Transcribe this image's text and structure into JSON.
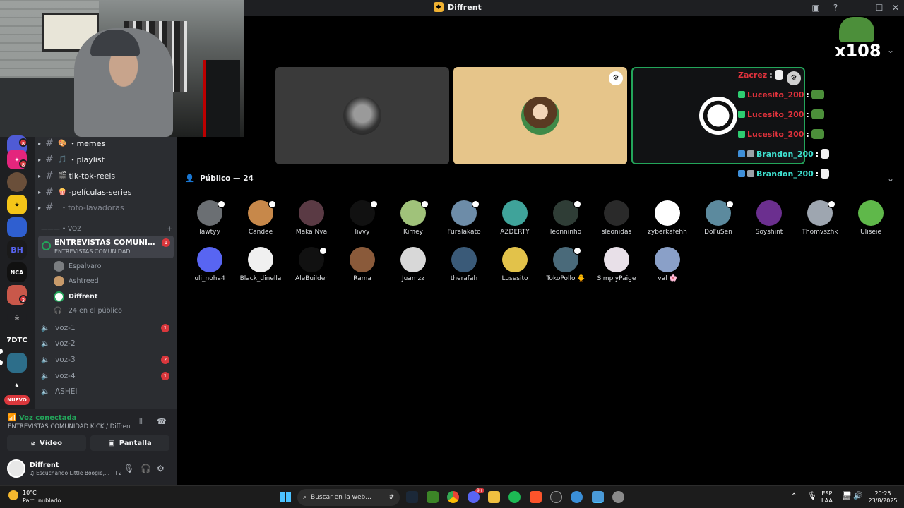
{
  "titlebar": {
    "app_title": "Diffrent"
  },
  "overlay": {
    "counter": "x108"
  },
  "badge": {
    "tile_channel_count": "3"
  },
  "servers": {
    "new_label": "NUEVO",
    "text_server": "7DTC"
  },
  "channels": {
    "text": [
      {
        "name": "・memes",
        "icon": "🎨"
      },
      {
        "name": "・playlist",
        "icon": "🎵"
      },
      {
        "name": "tik-tok-reels",
        "icon": "🎬"
      },
      {
        "name": "-películas-series",
        "icon": "🍿"
      },
      {
        "name": "・foto-lavadoras",
        "icon": ""
      }
    ],
    "category": "——— • VOZ",
    "category_add": "+",
    "stage": {
      "title": "ENTREVISTAS COMUNIDAD K...",
      "subtitle": "ENTREVISTAS COMUNIDAD",
      "badge": "1"
    },
    "stage_members": [
      "Espalvaro",
      "Ashtreed",
      "Diffrent"
    ],
    "audience_count_label": "24 en el público",
    "voice": [
      {
        "name": "voz-1",
        "badge": "1"
      },
      {
        "name": "voz-2",
        "badge": ""
      },
      {
        "name": "voz-3",
        "badge": "2"
      },
      {
        "name": "voz-4",
        "badge": "1"
      },
      {
        "name": "ASHEI",
        "badge": ""
      }
    ]
  },
  "voice_panel": {
    "status": "Voz conectada",
    "location": "ENTREVISTAS COMUNIDAD KICK / Diffrent",
    "video_label": "Vídeo",
    "screen_label": "Pantalla"
  },
  "user_panel": {
    "name": "Diffrent",
    "activity": "Escuchando Little Boogie,...",
    "extra": "+2"
  },
  "chat_overlay": [
    {
      "user": "Zacrez",
      "color": "#e0323c"
    },
    {
      "user": "Lucesito_200",
      "color": "#e0323c"
    },
    {
      "user": "Lucesito_200",
      "color": "#e0323c"
    },
    {
      "user": "Lucesito_200",
      "color": "#e0323c"
    },
    {
      "user": "Brandon_200",
      "color": "#3fe0d0"
    },
    {
      "user": "Brandon_200",
      "color": "#3fe0d0"
    }
  ],
  "audience": {
    "title": "Público — 24",
    "members": [
      {
        "name": "lawtyy",
        "color": "#6b6f73"
      },
      {
        "name": "Candee",
        "color": "#c7884a"
      },
      {
        "name": "Maka Nva",
        "color": "#5a3a44"
      },
      {
        "name": "livvy",
        "color": "#111111"
      },
      {
        "name": "Kimey",
        "color": "#a0c27a"
      },
      {
        "name": "Furalakato",
        "color": "#6d8ca8"
      },
      {
        "name": "AZDERTY",
        "color": "#3fa39a"
      },
      {
        "name": "leonninho",
        "color": "#2f3d36"
      },
      {
        "name": "sleonidas",
        "color": "#2a2a2a"
      },
      {
        "name": "zyberkafehh",
        "color": "#ffffff"
      },
      {
        "name": "DoFuSen",
        "color": "#5c8a9e"
      },
      {
        "name": "Soyshint",
        "color": "#6b2f8f"
      },
      {
        "name": "Thomvszhk",
        "color": "#9ea6b0"
      },
      {
        "name": "Uliseie",
        "color": "#5fb84a"
      },
      {
        "name": "uli_noha4",
        "color": "#5865f2"
      },
      {
        "name": "Black_dinella",
        "color": "#f0f0f0"
      },
      {
        "name": "AleBuilder",
        "color": "#111111"
      },
      {
        "name": "Rama",
        "color": "#8a5a3a"
      },
      {
        "name": "Juamzz",
        "color": "#d8d8d8"
      },
      {
        "name": "therafah",
        "color": "#3a5a78"
      },
      {
        "name": "Lusesito",
        "color": "#e2c24a"
      },
      {
        "name": "TokoPollo 🐥",
        "color": "#4a6a7a"
      },
      {
        "name": "SimplyPaige",
        "color": "#e8e0e8"
      },
      {
        "name": "val 🌸",
        "color": "#8aa0c8"
      }
    ]
  },
  "taskbar": {
    "temp": "10°C",
    "weather": "Parc. nublado",
    "search_placeholder": "Buscar en la web...",
    "lang": "ESP",
    "lang2": "LAA",
    "time": "20:25",
    "date": "23/8/2025",
    "notif": "9+"
  }
}
